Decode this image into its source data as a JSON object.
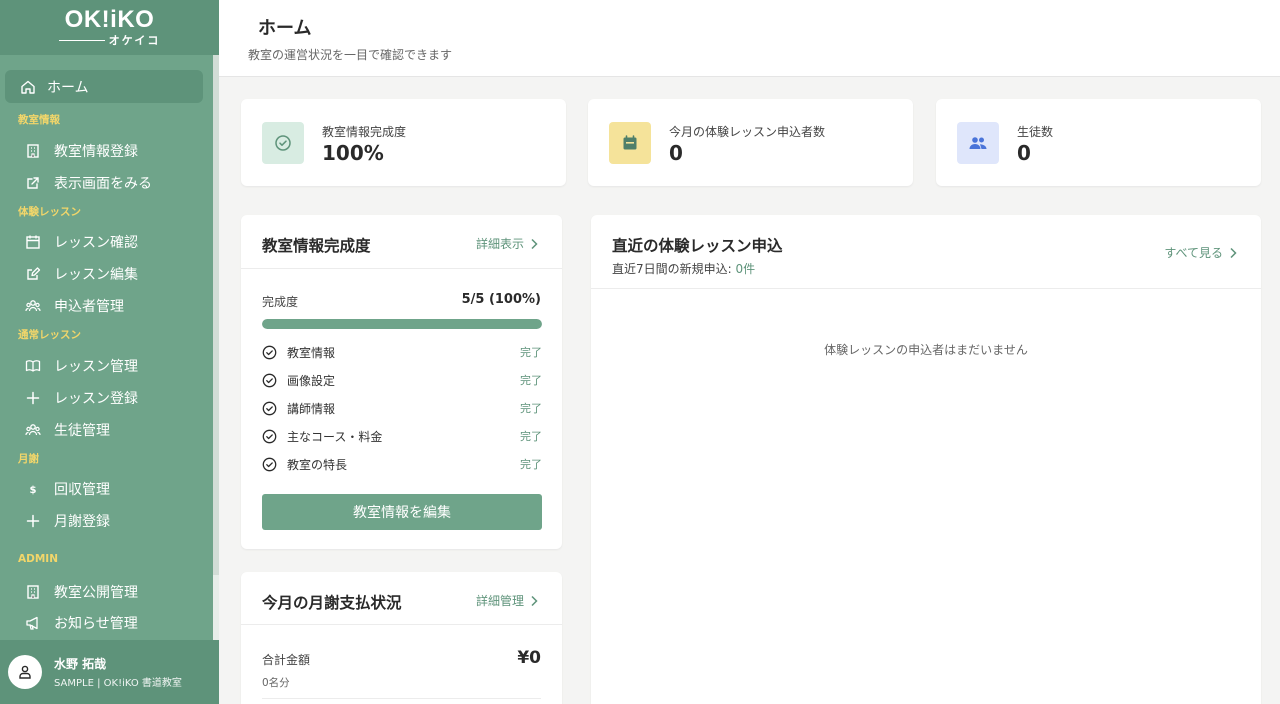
{
  "app": {
    "logo_main": "OK!iKO",
    "logo_sub": "オケイコ"
  },
  "sidebar": {
    "home": "ホーム",
    "sections": {
      "school_info": "教室情報",
      "trial": "体験レッスン",
      "regular": "通常レッスン",
      "monthly": "月謝",
      "admin": "ADMIN"
    },
    "items": {
      "school_register": "教室情報登録",
      "view_display": "表示画面をみる",
      "lesson_confirm": "レッスン確認",
      "lesson_edit": "レッスン編集",
      "applicant_manage": "申込者管理",
      "lesson_manage": "レッスン管理",
      "lesson_register": "レッスン登録",
      "student_manage": "生徒管理",
      "collection_manage": "回収管理",
      "fee_register": "月謝登録",
      "school_publish": "教室公開管理",
      "notice_manage": "お知らせ管理"
    },
    "user": {
      "name": "水野 拓哉",
      "sub": "SAMPLE | OK!iKO 書道教室"
    }
  },
  "header": {
    "title": "ホーム",
    "description": "教室の運営状況を一目で確認できます"
  },
  "stats": [
    {
      "label": "教室情報完成度",
      "value": "100%",
      "icon": "check-circle-icon",
      "bg": "#d8ece2",
      "color": "#5e937a"
    },
    {
      "label": "今月の体験レッスン申込者数",
      "value": "0",
      "icon": "calendar-icon",
      "bg": "#f5e39a",
      "color": "#4f7f6a"
    },
    {
      "label": "生徒数",
      "value": "0",
      "icon": "users-icon",
      "bg": "#dfe6fb",
      "color": "#4a74d9"
    }
  ],
  "completion": {
    "title": "教室情報完成度",
    "link": "詳細表示",
    "label": "完成度",
    "value": "5/5 (100%)",
    "progress": 1.0,
    "items": [
      {
        "label": "教室情報",
        "status": "完了"
      },
      {
        "label": "画像設定",
        "status": "完了"
      },
      {
        "label": "講師情報",
        "status": "完了"
      },
      {
        "label": "主なコース・料金",
        "status": "完了"
      },
      {
        "label": "教室の特長",
        "status": "完了"
      }
    ],
    "button": "教室情報を編集"
  },
  "monthly_fee": {
    "title": "今月の月謝支払状況",
    "link": "詳細管理",
    "total_label": "合計金額",
    "total_value": "¥0",
    "count": "0名分"
  },
  "recent": {
    "title": "直近の体験レッスン申込",
    "sub_prefix": "直近7日間の新規申込: ",
    "sub_count": "0件",
    "link": "すべて見る",
    "empty": "体験レッスンの申込者はまだいません"
  }
}
